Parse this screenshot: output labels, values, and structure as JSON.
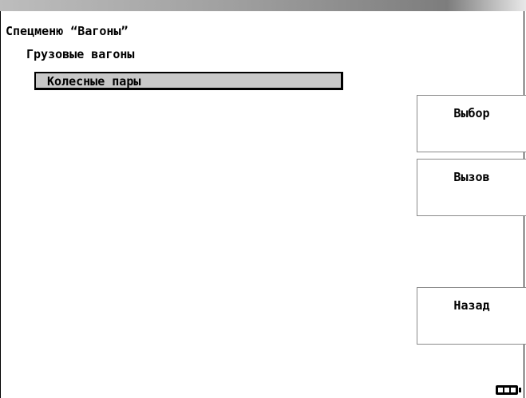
{
  "menu": {
    "title": "Спецменю “Вагоны”",
    "submenu": "Грузовые вагоны",
    "selected_item": "Колесные пары"
  },
  "buttons": {
    "select_label": "Выбор",
    "call_label": "Вызов",
    "back_label": "Назад"
  },
  "status": {
    "battery_icon": "battery-icon",
    "battery_level": 1.0
  },
  "colors": {
    "selection_bg": "#c8c8c8",
    "text": "#000000",
    "background": "#ffffff"
  }
}
